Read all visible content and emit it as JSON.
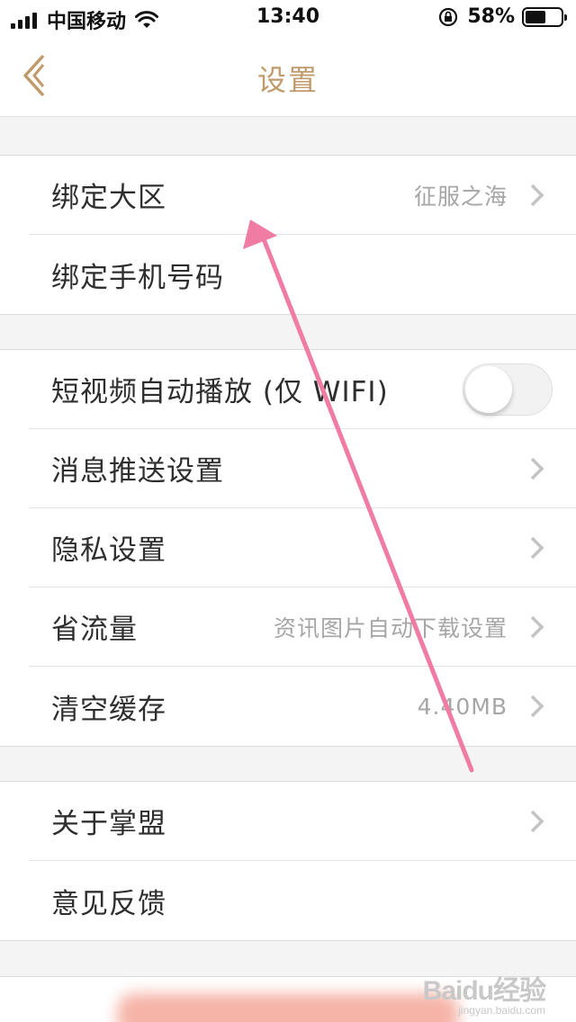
{
  "status_bar": {
    "carrier": "中国移动",
    "time": "13:40",
    "battery_percent": "58%",
    "battery_level": 0.58,
    "icons": [
      "signal-icon",
      "wifi-icon",
      "orientation-lock-icon",
      "battery-icon"
    ]
  },
  "nav": {
    "title": "设置",
    "back_icon": "chevron-left-icon",
    "accent_color": "#c19a6b"
  },
  "groups": [
    {
      "rows": [
        {
          "label": "绑定大区",
          "value": "征服之海",
          "chevron": true
        },
        {
          "label": "绑定手机号码",
          "value": "",
          "chevron": false
        }
      ]
    },
    {
      "rows": [
        {
          "label": "短视频自动播放 (仅 WIFI)",
          "toggle": false
        },
        {
          "label": "消息推送设置",
          "value": "",
          "chevron": true
        },
        {
          "label": "隐私设置",
          "value": "",
          "chevron": true
        },
        {
          "label": "省流量",
          "value": "资讯图片自动下载设置",
          "chevron": true
        },
        {
          "label": "清空缓存",
          "value": "4.40MB",
          "chevron": true
        }
      ]
    },
    {
      "rows": [
        {
          "label": "关于掌盟",
          "value": "",
          "chevron": true
        },
        {
          "label": "意见反馈",
          "value": "",
          "chevron": false
        }
      ]
    }
  ],
  "annotation": {
    "arrow_color": "#f07ba3"
  },
  "watermark": {
    "logo": "Baidu经验",
    "url": "jingyan.baidu.com"
  }
}
